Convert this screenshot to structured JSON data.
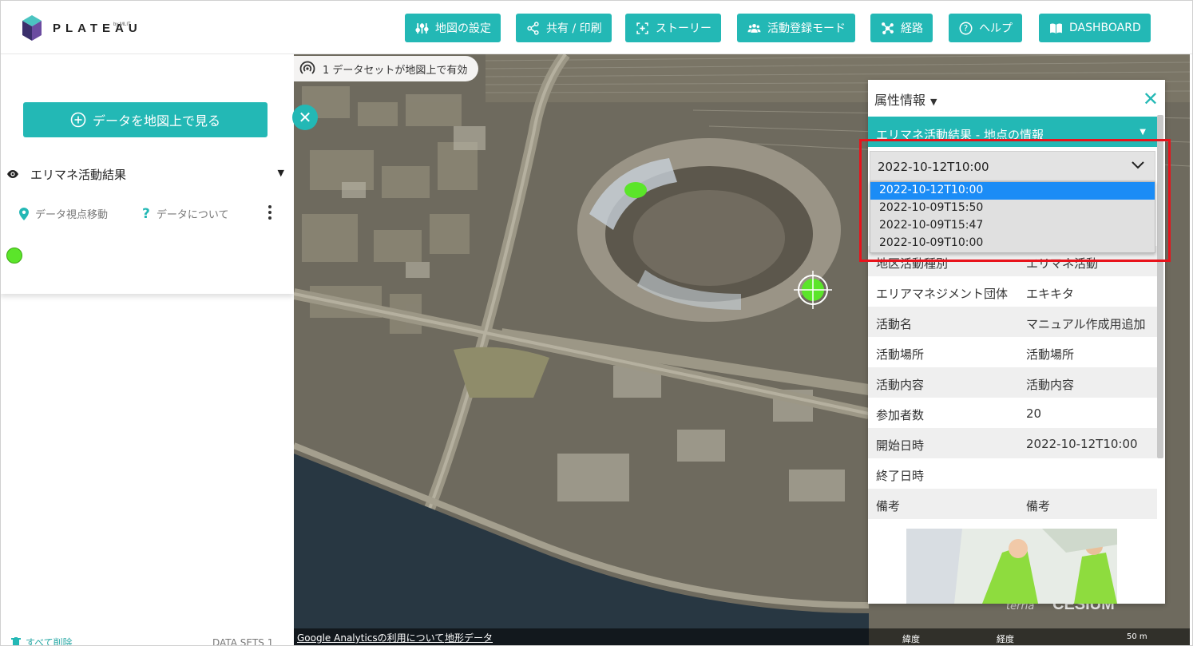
{
  "header": {
    "logo_text": "PLATEAU",
    "logo_sub": "by MLIT",
    "nav": [
      {
        "label": "地図の設定",
        "icon": "sliders-icon"
      },
      {
        "label": "共有 / 印刷",
        "icon": "share-icon"
      },
      {
        "label": "ストーリー",
        "icon": "story-icon"
      },
      {
        "label": "活動登録モード",
        "icon": "people-icon"
      },
      {
        "label": "経路",
        "icon": "route-icon"
      },
      {
        "label": "ヘルプ",
        "icon": "help-icon"
      },
      {
        "label": "DASHBOARD",
        "icon": "book-icon"
      }
    ]
  },
  "left_panel": {
    "add_data_label": "データを地図上で見る",
    "dataset": {
      "title": "エリマネ活動結果",
      "zoom_label": "データ視点移動",
      "about_label": "データについて",
      "legend_color": "#5be52a"
    },
    "clear_all_label": "すべて削除",
    "datasets_count": "DATA SETS 1"
  },
  "map": {
    "active_datasets_label": "1 データセットが地図上で有効",
    "footer": {
      "analytics_link": "Google Analyticsの利用について",
      "terrain_link": "地形データ",
      "lat_label": "緯度",
      "lon_label": "経度",
      "scale_label": "50 m"
    },
    "credits": {
      "terria": "terria",
      "cesium": "CESIUM"
    }
  },
  "feature_info": {
    "title": "属性情報",
    "section_title": "エリマネ活動結果 - 地点の情報",
    "selected_value": "2022-10-12T10:00",
    "options": [
      "2022-10-12T10:00",
      "2022-10-09T15:50",
      "2022-10-09T15:47",
      "2022-10-09T10:00"
    ],
    "rows": [
      {
        "key": "地区活動種別",
        "value": "エリマネ活動"
      },
      {
        "key": "エリアマネジメント団体",
        "value": "エキキタ"
      },
      {
        "key": "活動名",
        "value": "マニュアル作成用追加"
      },
      {
        "key": "活動場所",
        "value": "活動場所"
      },
      {
        "key": "活動内容",
        "value": "活動内容"
      },
      {
        "key": "参加者数",
        "value": "20"
      },
      {
        "key": "開始日時",
        "value": "2022-10-12T10:00"
      },
      {
        "key": "終了日時",
        "value": ""
      },
      {
        "key": "備考",
        "value": "備考"
      }
    ]
  },
  "colors": {
    "accent": "#23b8b5",
    "highlight": "#e8131b",
    "option_selected": "#1b8cf6"
  }
}
